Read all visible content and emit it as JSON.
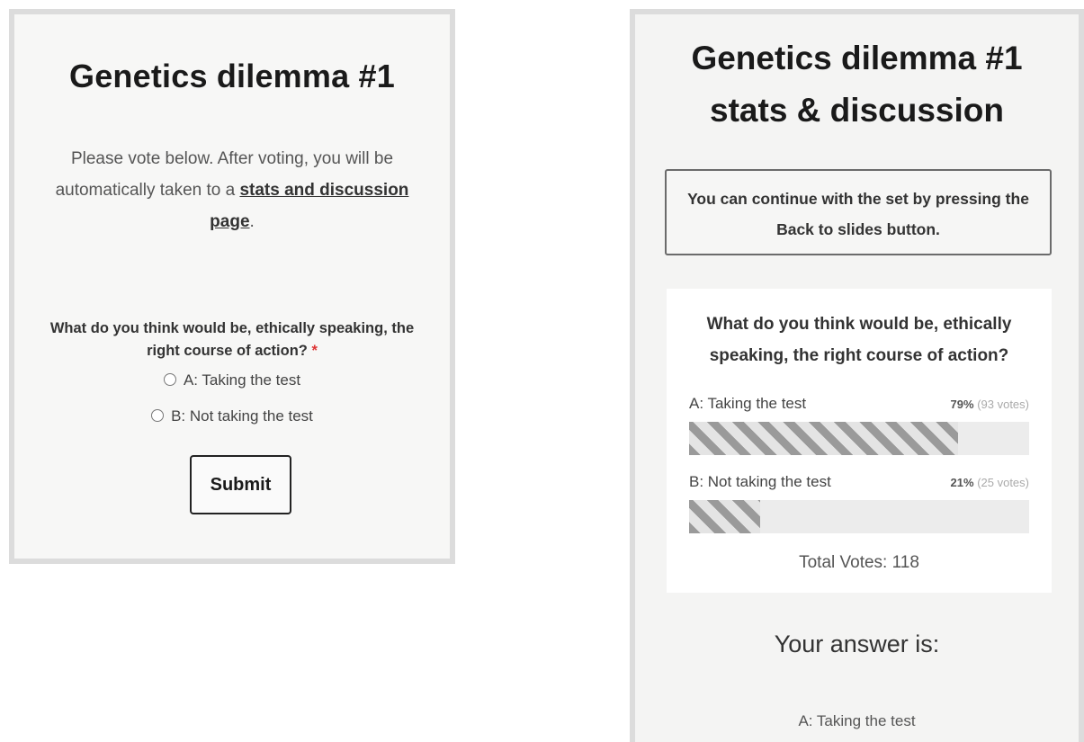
{
  "vote_form": {
    "title": "Genetics dilemma #1",
    "intro_text": "Please vote below. After voting, you will be automatically taken to a ",
    "intro_link": "stats and discussion page",
    "intro_end": ".",
    "question": "What do you think would be, ethically speaking, the right course of action?",
    "required_marker": "*",
    "options": [
      {
        "label": "A: Taking the test"
      },
      {
        "label": "B: Not taking the test"
      }
    ],
    "submit_label": "Submit"
  },
  "results_page": {
    "title": "Genetics dilemma #1 stats & discussion",
    "notice": "You can continue with the set by pressing the Back to slides button.",
    "question": "What do you think would be, ethically speaking, the right course of action?",
    "results": [
      {
        "label": "A: Taking the test",
        "percent_text": "79%",
        "votes_text": "(93 votes)",
        "percent": 79
      },
      {
        "label": "B: Not taking the test",
        "percent_text": "21%",
        "votes_text": "(25 votes)",
        "percent": 21
      }
    ],
    "total_votes": "Total Votes: 118",
    "answer_heading": "Your answer is:",
    "answer_value": "A: Taking the test"
  },
  "colors": {
    "required": "#dd3333",
    "bar_stripe": "#9a9a9a",
    "bar_track": "#ececec"
  }
}
